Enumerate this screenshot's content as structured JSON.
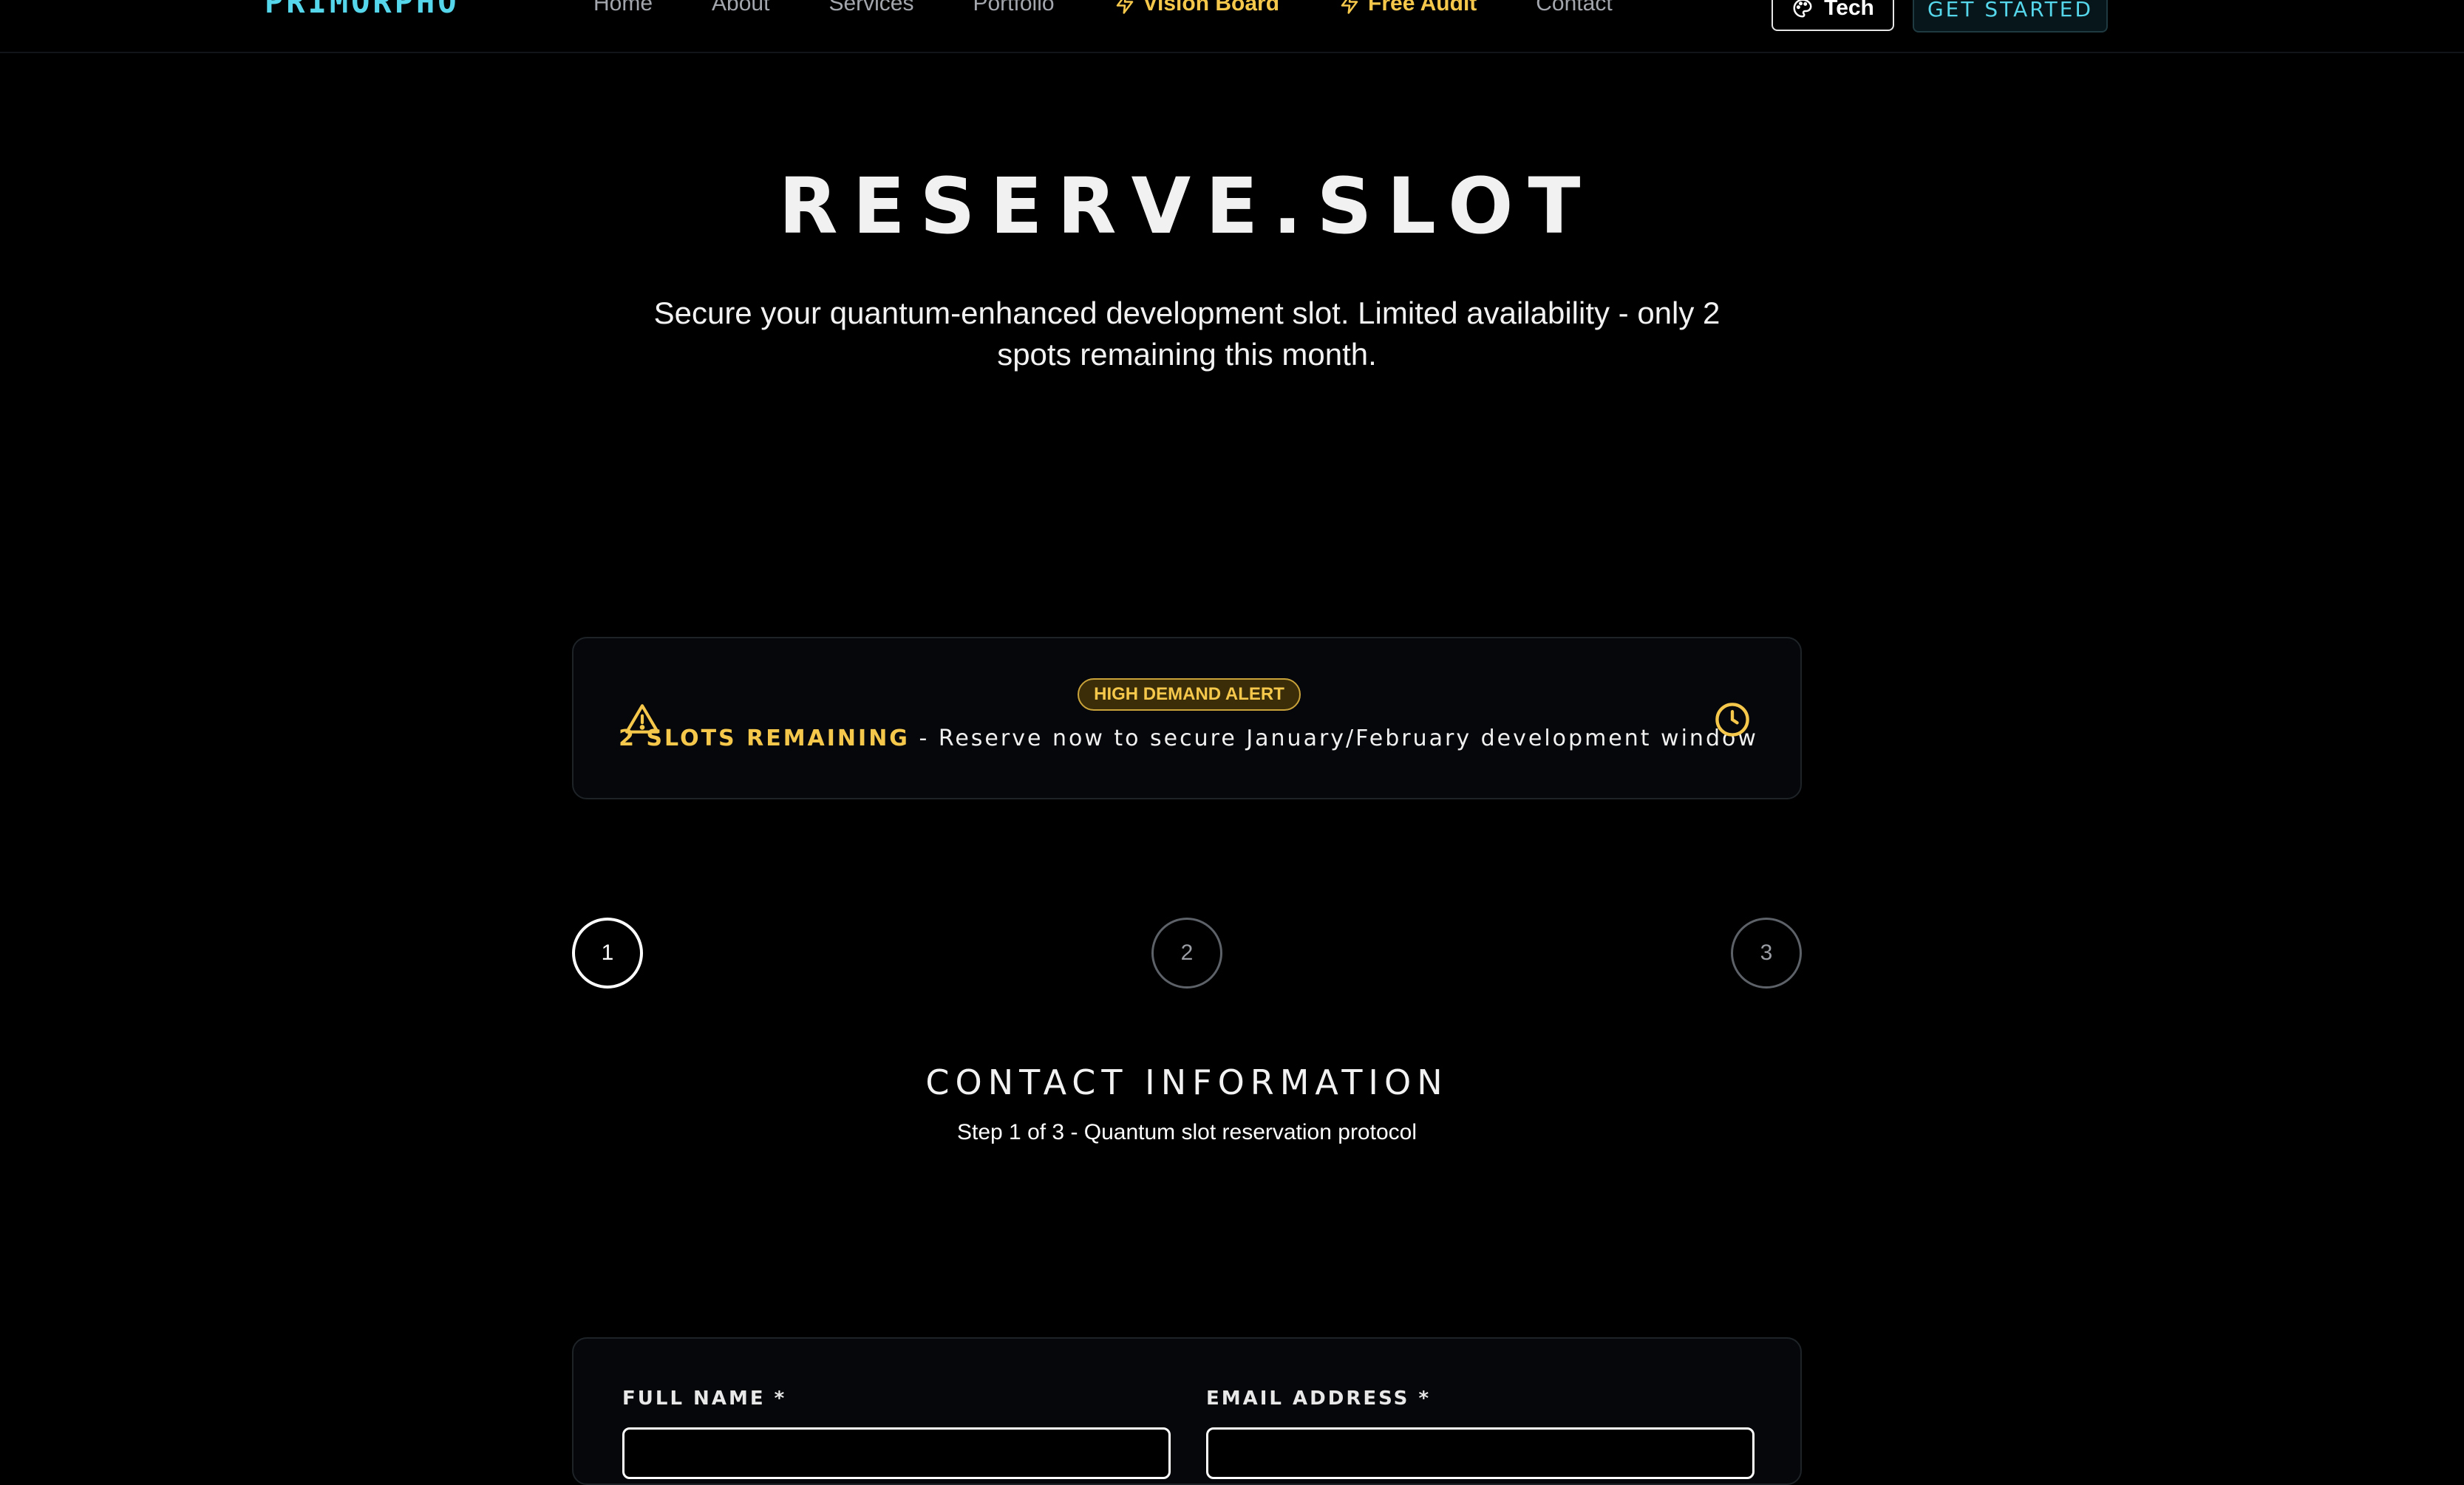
{
  "nav": {
    "brand": "PRIMORPHO",
    "links": [
      {
        "label": "Home"
      },
      {
        "label": "About"
      },
      {
        "label": "Services"
      },
      {
        "label": "Portfolio"
      },
      {
        "label": "Vision Board",
        "icon": "lightning-icon"
      },
      {
        "label": "Free Audit",
        "icon": "lightning-icon"
      },
      {
        "label": "Contact"
      }
    ],
    "theme_label": "Tech",
    "theme_icon": "palette-icon",
    "cta_label": "GET STARTED"
  },
  "hero": {
    "title": "RESERVE.SLOT",
    "subtitle": "Secure your quantum-enhanced development slot. Limited availability - only 2 spots remaining this month."
  },
  "alert": {
    "badge": "HIGH DEMAND ALERT",
    "highlight": "2 SLOTS REMAINING",
    "message": " - Reserve now to secure January/February development window",
    "left_icon": "warning-icon",
    "right_icon": "clock-icon"
  },
  "stepper": {
    "steps": [
      "1",
      "2",
      "3"
    ],
    "active": 1
  },
  "section": {
    "title": "CONTACT INFORMATION",
    "subtitle": "Step 1 of 3 - Quantum slot reservation protocol"
  },
  "form": {
    "full_name_label": "FULL NAME *",
    "email_label": "EMAIL ADDRESS *"
  },
  "colors": {
    "accent_cyan": "#56d6ea",
    "accent_yellow": "#f5c84c",
    "background": "#000000"
  }
}
